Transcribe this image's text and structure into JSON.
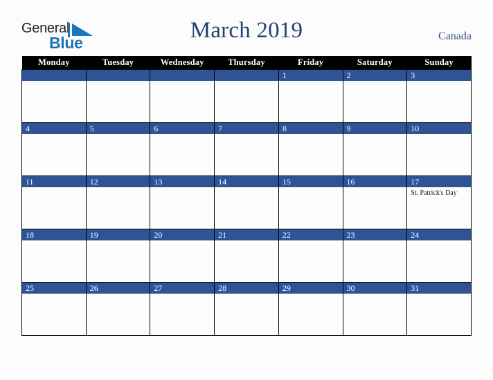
{
  "brand": {
    "name_part1": "General",
    "name_part2": "Blue",
    "mark": "triangle-icon",
    "accent_color": "#1b75bb",
    "text_color": "#231f20"
  },
  "header": {
    "title": "March 2019",
    "country": "Canada",
    "title_color": "#27406c",
    "country_color": "#3a5382"
  },
  "calendar": {
    "month": "March",
    "year": "2019",
    "first_day_of_week": "Monday",
    "weekday_headers": [
      "Monday",
      "Tuesday",
      "Wednesday",
      "Thursday",
      "Friday",
      "Saturday",
      "Sunday"
    ],
    "header_bg": "#000000",
    "header_text": "#ffffff",
    "daynum_bg": "#2e5496",
    "daynum_text": "#ffffff",
    "cell_bg": "#fdfdfd",
    "border_color": "#000000",
    "weeks": [
      [
        {
          "day": "",
          "events": []
        },
        {
          "day": "",
          "events": []
        },
        {
          "day": "",
          "events": []
        },
        {
          "day": "",
          "events": []
        },
        {
          "day": "1",
          "events": []
        },
        {
          "day": "2",
          "events": []
        },
        {
          "day": "3",
          "events": []
        }
      ],
      [
        {
          "day": "4",
          "events": []
        },
        {
          "day": "5",
          "events": []
        },
        {
          "day": "6",
          "events": []
        },
        {
          "day": "7",
          "events": []
        },
        {
          "day": "8",
          "events": []
        },
        {
          "day": "9",
          "events": []
        },
        {
          "day": "10",
          "events": []
        }
      ],
      [
        {
          "day": "11",
          "events": []
        },
        {
          "day": "12",
          "events": []
        },
        {
          "day": "13",
          "events": []
        },
        {
          "day": "14",
          "events": []
        },
        {
          "day": "15",
          "events": []
        },
        {
          "day": "16",
          "events": []
        },
        {
          "day": "17",
          "events": [
            "St. Patrick's Day"
          ]
        }
      ],
      [
        {
          "day": "18",
          "events": []
        },
        {
          "day": "19",
          "events": []
        },
        {
          "day": "20",
          "events": []
        },
        {
          "day": "21",
          "events": []
        },
        {
          "day": "22",
          "events": []
        },
        {
          "day": "23",
          "events": []
        },
        {
          "day": "24",
          "events": []
        }
      ],
      [
        {
          "day": "25",
          "events": []
        },
        {
          "day": "26",
          "events": []
        },
        {
          "day": "27",
          "events": []
        },
        {
          "day": "28",
          "events": []
        },
        {
          "day": "29",
          "events": []
        },
        {
          "day": "30",
          "events": []
        },
        {
          "day": "31",
          "events": []
        }
      ]
    ]
  }
}
